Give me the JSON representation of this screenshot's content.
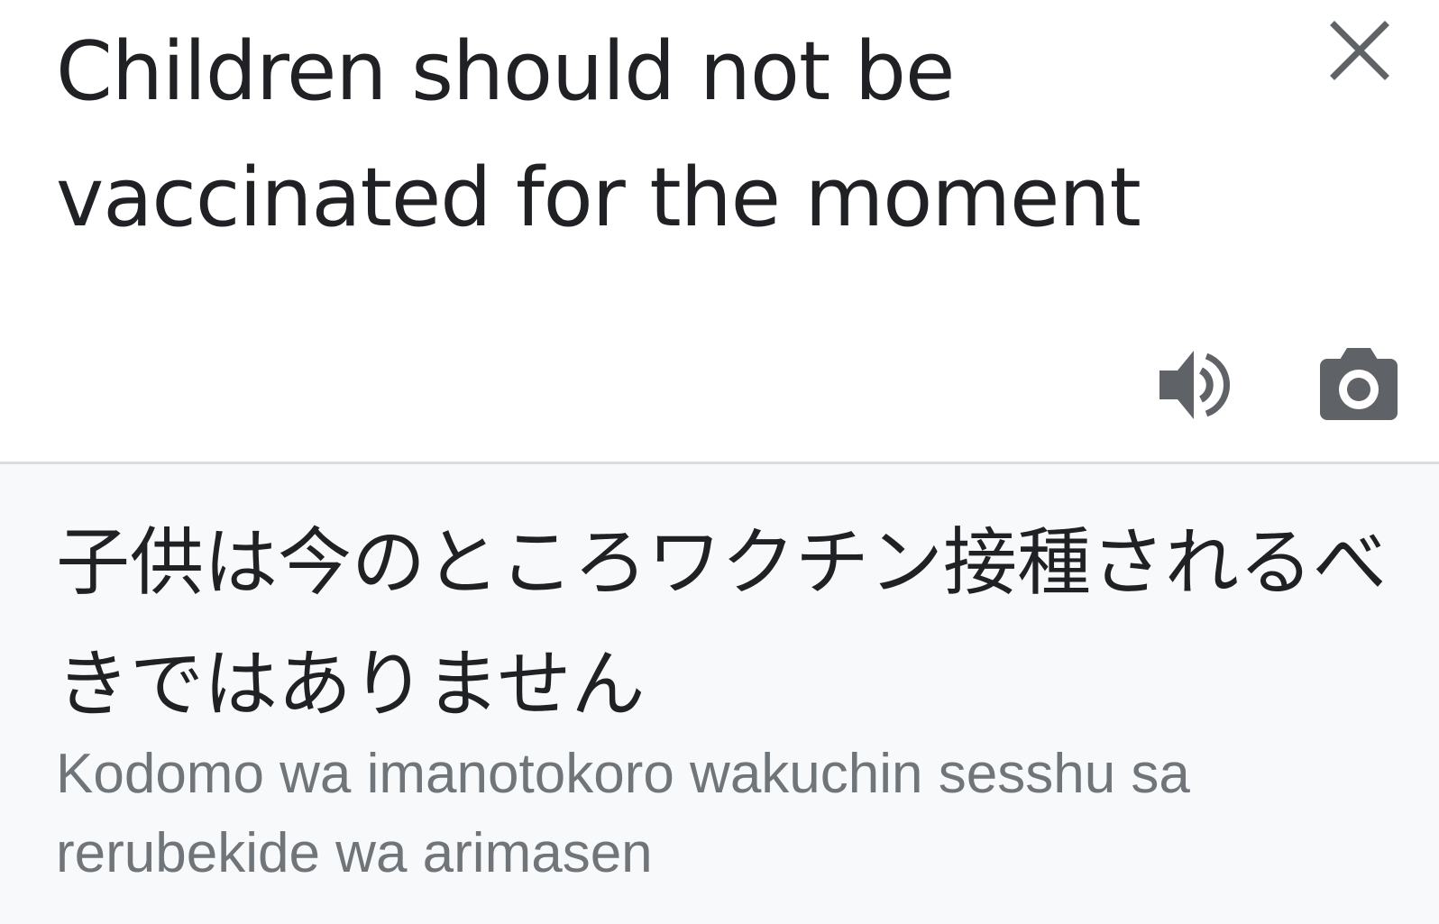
{
  "source": {
    "text": "Children should not be vaccinated for the moment",
    "close_icon": "close-icon",
    "speaker_icon": "speaker-icon",
    "camera_icon": "camera-icon"
  },
  "result": {
    "translation": "子供は今のところワクチン接種されるべきではありません",
    "romanization": "Kodomo wa imanotokoro wakuchin sesshu sa rerubekide wa arimasen"
  },
  "colors": {
    "text_primary": "#202124",
    "text_secondary": "#70757a",
    "icon": "#5f6368",
    "result_background": "#f8f9fa",
    "divider": "#dadce0"
  }
}
